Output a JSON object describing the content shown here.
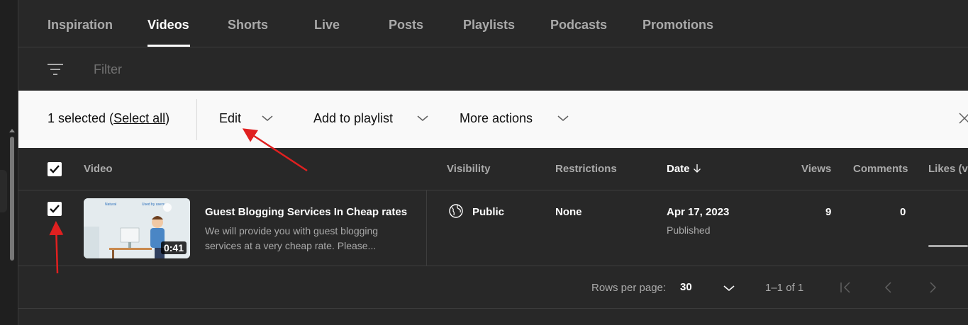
{
  "tabs": [
    "Inspiration",
    "Videos",
    "Shorts",
    "Live",
    "Posts",
    "Playlists",
    "Podcasts",
    "Promotions"
  ],
  "active_tab": "Videos",
  "filter": {
    "placeholder": "Filter"
  },
  "selection": {
    "count_text": "1 selected (",
    "select_all": "Select all",
    "close_paren": ")"
  },
  "actions": {
    "edit": "Edit",
    "add_to_playlist": "Add to playlist",
    "more_actions": "More actions"
  },
  "table": {
    "headers": {
      "video": "Video",
      "visibility": "Visibility",
      "restrictions": "Restrictions",
      "date": "Date",
      "views": "Views",
      "comments": "Comments",
      "likes": "Likes (vs"
    },
    "rows": [
      {
        "title": "Guest Blogging Services In Cheap rates",
        "description": "We will provide you with guest blogging services at a very cheap rate. Please...",
        "duration": "0:41",
        "thumb_left": "Natural",
        "thumb_right": "Used by users",
        "visibility": "Public",
        "restrictions": "None",
        "date": "Apr 17, 2023",
        "date_status": "Published",
        "views": "9",
        "comments": "0",
        "likes_fill": 0.5
      }
    ]
  },
  "pagination": {
    "rows_label": "Rows per page:",
    "rows_value": "30",
    "range": "1–1 of 1"
  },
  "colors": {
    "background": "#282828",
    "selection_bar": "#f9f9f9",
    "annotation_arrow": "#e02020"
  }
}
